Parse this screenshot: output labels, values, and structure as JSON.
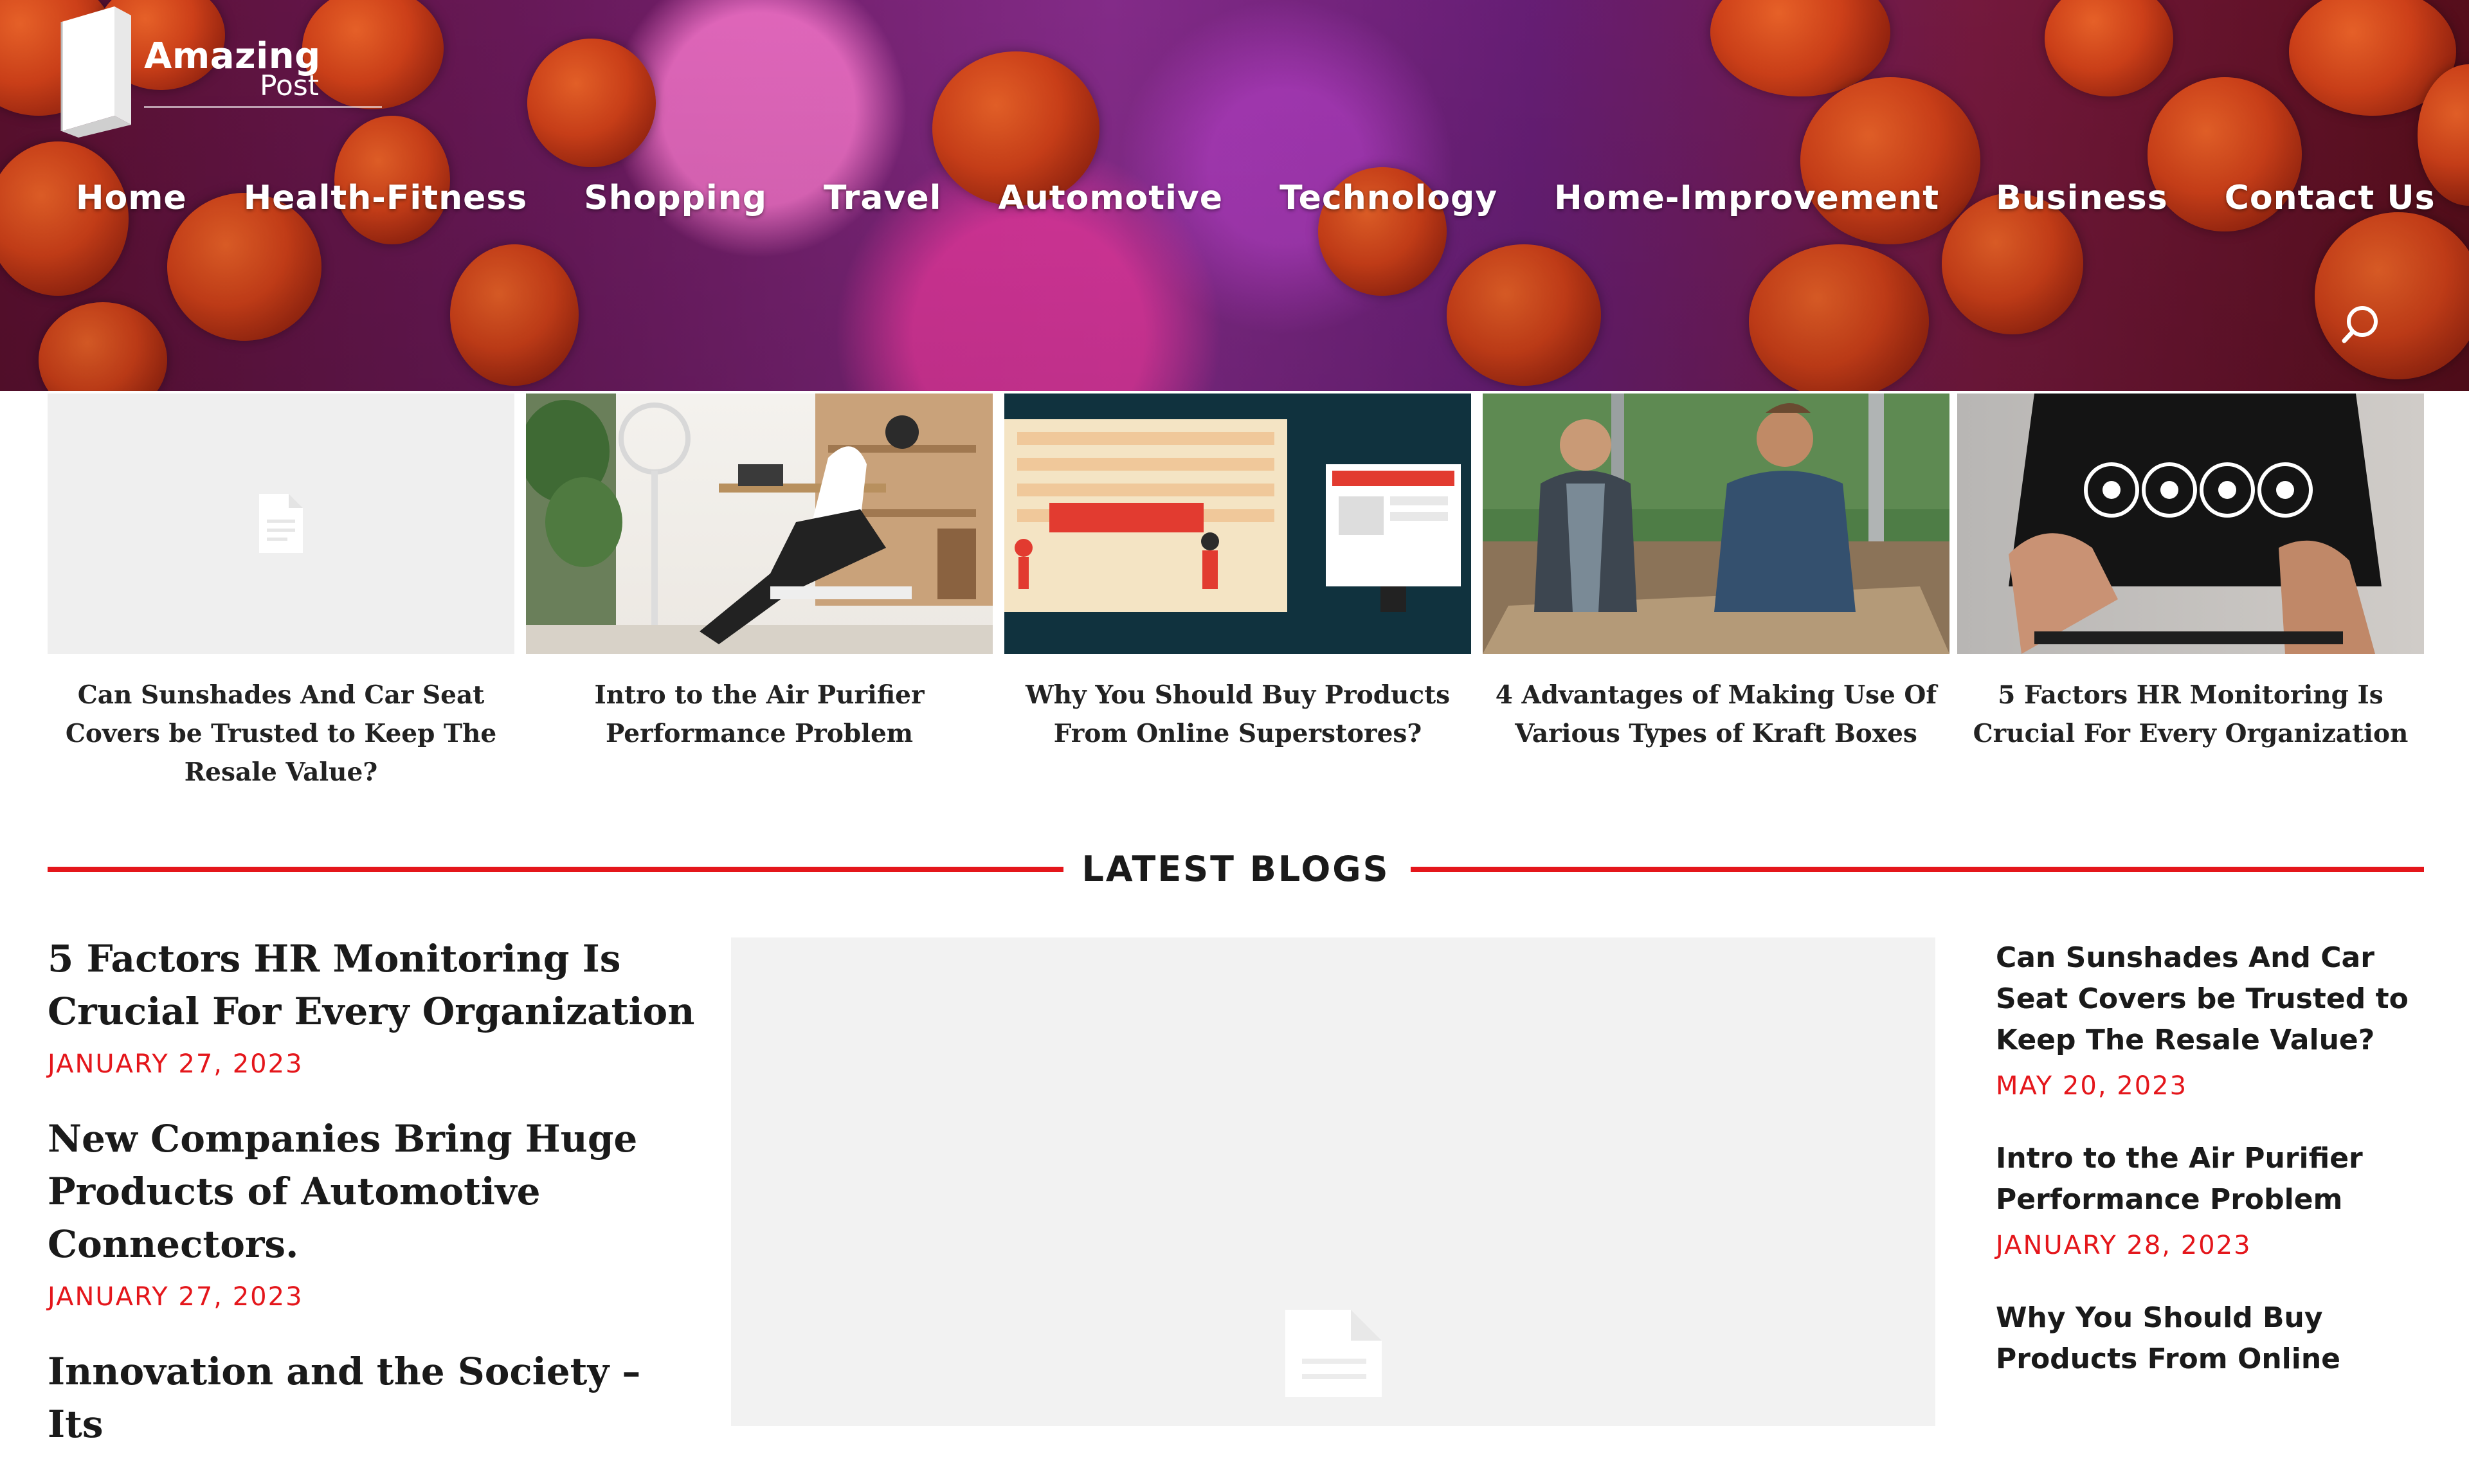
{
  "colors": {
    "accent": "#e4161b",
    "text": "#1a1a1a",
    "placeholder": "#f2f2f2"
  },
  "header": {
    "logo": {
      "line1": "Amazing",
      "line2": "Post"
    },
    "nav": [
      {
        "label": "Home"
      },
      {
        "label": "Health-Fitness"
      },
      {
        "label": "Shopping"
      },
      {
        "label": "Travel"
      },
      {
        "label": "Automotive"
      },
      {
        "label": "Technology"
      },
      {
        "label": "Home-Improvement"
      },
      {
        "label": "Business"
      },
      {
        "label": "Contact Us"
      }
    ],
    "search_icon": "search-icon"
  },
  "featured": [
    {
      "title": "Can Sunshades And Car Seat Covers be Trusted to Keep The Resale Value?",
      "image": "placeholder-document-icon"
    },
    {
      "title": "Intro to the Air Purifier Performance Problem",
      "image": "man-relaxing-by-fan"
    },
    {
      "title": "Why You Should Buy Products From Online Superstores?",
      "image": "online-store-illustration"
    },
    {
      "title": "4 Advantages of Making Use Of Various Types of Kraft Boxes",
      "image": "workers-with-cardboard"
    },
    {
      "title": "5 Factors HR Monitoring Is Crucial For Every Organization",
      "image": "hr-icons-touchscreen"
    }
  ],
  "latest": {
    "heading": "LATEST BLOGS",
    "left": [
      {
        "title": "5 Factors HR Monitoring Is Crucial For Every Organization",
        "date": "JANUARY 27, 2023"
      },
      {
        "title": "New Companies Bring Huge Products of Automotive Connectors.",
        "date": "JANUARY 27, 2023"
      },
      {
        "title": "Innovation and the Society – Its",
        "date": ""
      }
    ],
    "right": [
      {
        "title": "Can Sunshades And Car Seat Covers be Trusted to Keep The Resale Value?",
        "date": "MAY 20, 2023"
      },
      {
        "title": "Intro to the Air Purifier Performance Problem",
        "date": "JANUARY 28, 2023"
      },
      {
        "title": "Why You Should Buy Products From Online",
        "date": ""
      }
    ]
  }
}
